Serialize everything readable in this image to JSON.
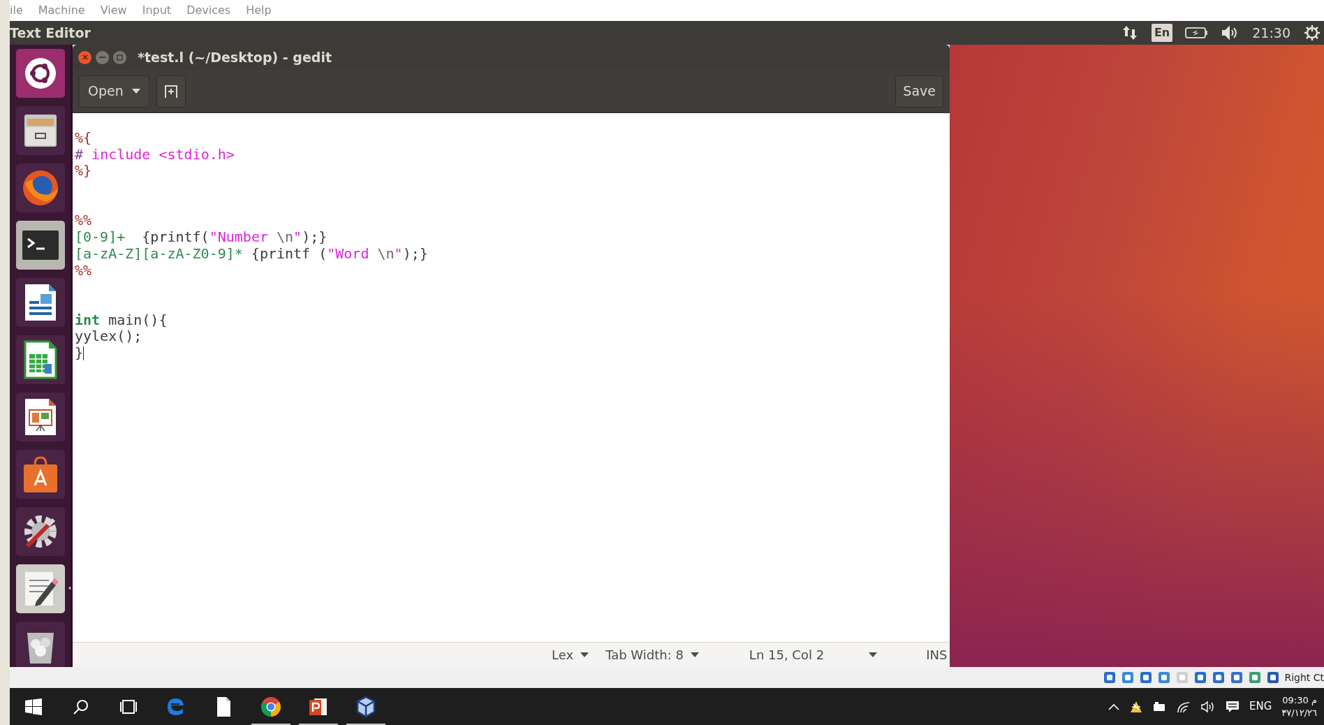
{
  "vm_menu": [
    "ile",
    "Machine",
    "View",
    "Input",
    "Devices",
    "Help"
  ],
  "top_panel": {
    "title": "Text Editor",
    "keyboard_layout": "En",
    "clock": "21:30"
  },
  "launcher": [
    {
      "kind": "dash",
      "running": false
    },
    {
      "kind": "files",
      "running": false
    },
    {
      "kind": "firefox",
      "running": false
    },
    {
      "kind": "terminal",
      "running": false
    },
    {
      "kind": "writer",
      "running": false
    },
    {
      "kind": "calc",
      "running": false
    },
    {
      "kind": "impress",
      "running": false
    },
    {
      "kind": "software",
      "running": false
    },
    {
      "kind": "settings",
      "running": false
    },
    {
      "kind": "editor",
      "running": true
    },
    {
      "kind": "trash",
      "running": false
    }
  ],
  "window": {
    "title": "*test.l (~/Desktop) - gedit",
    "open_button": "Open",
    "save_button": "Save"
  },
  "editor": {
    "lines": [
      {
        "kind": "code",
        "cursor": false,
        "tokens": [
          {
            "text": "%{",
            "kind": "preproc"
          }
        ]
      },
      {
        "kind": "code",
        "cursor": false,
        "tokens": [
          {
            "text": "# ",
            "kind": "hash"
          },
          {
            "text": "include <stdio.h>",
            "kind": "string"
          }
        ]
      },
      {
        "kind": "code",
        "cursor": false,
        "tokens": [
          {
            "text": "%}",
            "kind": "preproc"
          }
        ]
      },
      {
        "kind": "blank",
        "cursor": false
      },
      {
        "kind": "blank",
        "cursor": false
      },
      {
        "kind": "code",
        "cursor": false,
        "tokens": [
          {
            "text": "%%",
            "kind": "preproc"
          }
        ]
      },
      {
        "kind": "code",
        "cursor": false,
        "tokens": [
          {
            "text": "[0-9]+",
            "kind": "pattern"
          },
          {
            "text": "  {printf(",
            "kind": "plain"
          },
          {
            "text": "\"Number ",
            "kind": "string"
          },
          {
            "text": "\\n",
            "kind": "escape"
          },
          {
            "text": "\"",
            "kind": "string"
          },
          {
            "text": ");}",
            "kind": "plain"
          }
        ]
      },
      {
        "kind": "code",
        "cursor": false,
        "tokens": [
          {
            "text": "[a-zA-Z][a-zA-Z0-9]*",
            "kind": "pattern"
          },
          {
            "text": " {printf (",
            "kind": "plain"
          },
          {
            "text": "\"Word ",
            "kind": "string"
          },
          {
            "text": "\\n",
            "kind": "escape"
          },
          {
            "text": "\"",
            "kind": "string"
          },
          {
            "text": ");}",
            "kind": "plain"
          }
        ]
      },
      {
        "kind": "code",
        "cursor": false,
        "tokens": [
          {
            "text": "%%",
            "kind": "preproc"
          }
        ]
      },
      {
        "kind": "blank",
        "cursor": false
      },
      {
        "kind": "blank",
        "cursor": false
      },
      {
        "kind": "code",
        "cursor": false,
        "tokens": [
          {
            "text": "int",
            "kind": "type"
          },
          {
            "text": " main(){",
            "kind": "plain"
          }
        ]
      },
      {
        "kind": "code",
        "cursor": false,
        "tokens": [
          {
            "text": "yylex();",
            "kind": "plain"
          }
        ]
      },
      {
        "kind": "code",
        "cursor": true,
        "tokens": [
          {
            "text": "}",
            "kind": "plain"
          }
        ]
      }
    ]
  },
  "status_bar": {
    "language": "Lex",
    "tab_width": "Tab Width: 8",
    "position": "Ln 15, Col 2",
    "mode": "INS"
  },
  "vm_status": {
    "host_key": "Right Ct"
  },
  "taskbar": {
    "apps": [
      {
        "kind": "edge",
        "running": false
      },
      {
        "kind": "file",
        "running": false
      },
      {
        "kind": "chrome",
        "running": true
      },
      {
        "kind": "powerpoint",
        "running": true
      },
      {
        "kind": "virtualbox",
        "running": true
      }
    ],
    "language": "ENG",
    "time": "09:30 م",
    "date": "٣٧/١٢/٢٦"
  }
}
